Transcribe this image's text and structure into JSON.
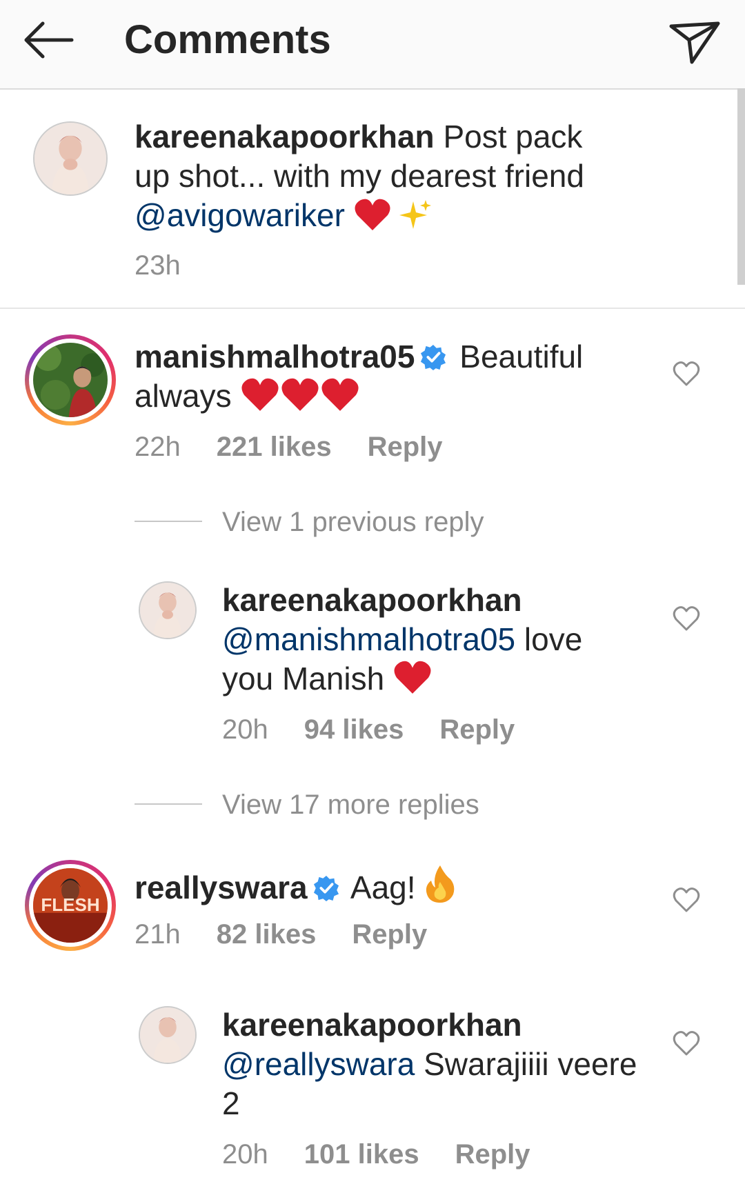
{
  "header": {
    "title": "Comments"
  },
  "caption": {
    "username": "kareenakapoorkhan",
    "text_part1": "Post pack",
    "text_part2": "up shot... with my dearest friend",
    "mention": "@avigowariker",
    "time": "23h"
  },
  "comments": [
    {
      "username": "manishmalhotra05",
      "verified": true,
      "text_line1": "Beautiful",
      "text_line2": "always",
      "time": "22h",
      "likes": "221 likes",
      "reply": "Reply",
      "view_replies": "View 1 previous reply"
    },
    {
      "username": "kareenakapoorkhan",
      "mention": "@manishmalhotra05",
      "text_part1": "love",
      "text_part2": "you Manish",
      "time": "20h",
      "likes": "94 likes",
      "reply": "Reply",
      "view_replies": "View 17 more replies"
    },
    {
      "username": "reallyswara",
      "verified": true,
      "text": "Aag!",
      "avatar_text": "FLESH",
      "time": "21h",
      "likes": "82 likes",
      "reply": "Reply"
    },
    {
      "username": "kareenakapoorkhan",
      "mention": "@reallyswara",
      "text_part1": "Swarajiiii veere",
      "text_part2": "2",
      "time": "20h",
      "likes": "101 likes",
      "reply": "Reply"
    }
  ],
  "icons": {
    "back": "arrow-left-icon",
    "send": "paper-plane-icon",
    "like": "heart-outline-icon",
    "verified": "verified-badge-icon",
    "heart_emoji": "red-heart-emoji",
    "sparkles_emoji": "sparkles-emoji",
    "fire_emoji": "fire-emoji"
  },
  "colors": {
    "mention": "#003569",
    "meta": "#8e8e8e",
    "verified": "#3897f0",
    "heart": "#e0202f"
  }
}
